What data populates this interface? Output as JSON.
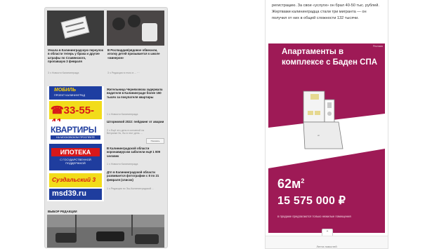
{
  "left": {
    "top_news": [
      {
        "title": "Уехала в Калининградскую переулок в области теперь у брака и другие штрафы по Славянского, пропавшую 3 февраля",
        "meta": "3 ч  Новости Калининграда"
      },
      {
        "title": "В Росгвардия/рядовое обвесили, иголку детей призывается к школе «минерон»",
        "meta": "3 ч  Редакция в этого в ...  ⋯"
      }
    ],
    "ad_banners": {
      "mosgil_logo": "МОБИЛЬ",
      "mosgil_sub": "ПРОЕКТ КАЛИНИНГРАД",
      "phone": "☎33-55-41",
      "kvartiry": "КВАРТИРЫ",
      "kvartiry_sub": "НА МОСКОВСКОМ ПРОСПЕКТЕ",
      "ipoteka": "ИПОТЕКА",
      "ipoteka_sub": "С ГОСУДАРСТВЕННОЙ ПОДДЕРЖКОЙ",
      "suzdal": "Суздальский 3",
      "site": "msd39.ru"
    },
    "side_news": [
      {
        "title": "Жительница Черняховска задержала водителя в Калининграде более 150 тысяч за покупателя квартиры",
        "meta": "1 ч  Новости Калининграда"
      },
      {
        "title": "Штормовой 2022: пейджинг от аварии",
        "meta": "2 ч  Ещё это день в основной на Ветрянке №, бы в этот день ..."
      },
      {
        "title": "В Калининградской области коронавирусом заболели ещё 1 009 человек",
        "meta": "1 ч  Новости Калининграда"
      },
      {
        "title": "Дтп в Калининградской области развивается фотографии с 8 по 21 февраля (список)",
        "meta": "1 ч  Редакция по Эш-Калининградской ..."
      }
    ],
    "more_button": "Показать",
    "section_label": "ВЫБОР РЕДАКЦИИ"
  },
  "right": {
    "article_text": "регистрацию. За свои «услуги» он брал 40-50 тыс. рублей. Жертвами калининградца стали три мигранта — он получил от них в общей сложности 132 тысячи.",
    "banner": {
      "mark": "Реклама",
      "title": "Апартаменты в комплексе с Баден СПА",
      "area": "62м",
      "area_sup": "2",
      "price": "15 575 000 ₽",
      "note": "в продаже предлагаются только нежилые помещения"
    },
    "scroll_up": "⌃",
    "bottom_label": "Лента новостей"
  },
  "colors": {
    "banner_bg": "#9e1a56",
    "ad_blue": "#1f3d9e",
    "ad_yellow": "#f2dc1a",
    "ad_red": "#d8181a"
  }
}
